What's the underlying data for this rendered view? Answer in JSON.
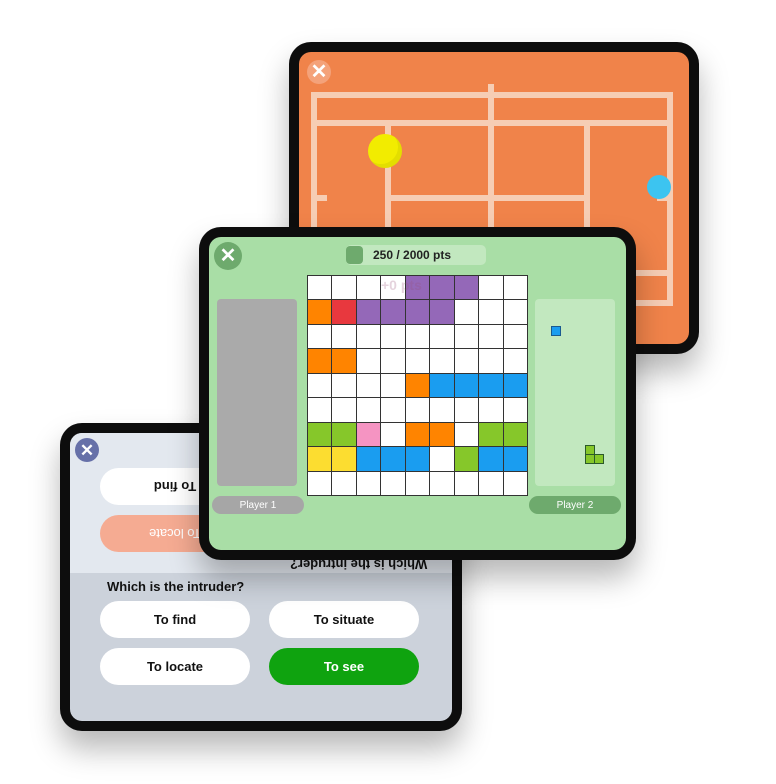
{
  "tennis_game": {
    "close_icon": "✕",
    "court_color": "#f0834a",
    "line_color": "#f6cdb4",
    "balls": [
      {
        "name": "yellow-tennis-ball",
        "color": "#f2ec00"
      },
      {
        "name": "blue-tennis-ball",
        "color": "#3cc4f0"
      }
    ]
  },
  "puzzle_game": {
    "close_icon": "✕",
    "score": "250",
    "score_separator": " / ",
    "score_total": "2000 pts",
    "score_label": "250  / 2000 pts",
    "ghost_text": "+0 pts",
    "grid": [
      [
        "#ffffff",
        "#ffffff",
        "#ffffff",
        "#ffffff",
        "#9468b8",
        "#9468b8",
        "#9468b8",
        "#ffffff",
        "#ffffff"
      ],
      [
        "#ff8400",
        "#e8383e",
        "#9468b8",
        "#9468b8",
        "#9468b8",
        "#9468b8",
        "#ffffff",
        "#ffffff",
        "#ffffff"
      ],
      [
        "#ffffff",
        "#ffffff",
        "#ffffff",
        "#ffffff",
        "#ffffff",
        "#ffffff",
        "#ffffff",
        "#ffffff",
        "#ffffff"
      ],
      [
        "#ff8400",
        "#ff8400",
        "#ffffff",
        "#ffffff",
        "#ffffff",
        "#ffffff",
        "#ffffff",
        "#ffffff",
        "#ffffff"
      ],
      [
        "#ffffff",
        "#ffffff",
        "#ffffff",
        "#ffffff",
        "#ff8400",
        "#1a9df0",
        "#1a9df0",
        "#1a9df0",
        "#1a9df0"
      ],
      [
        "#ffffff",
        "#ffffff",
        "#ffffff",
        "#ffffff",
        "#ffffff",
        "#ffffff",
        "#ffffff",
        "#ffffff",
        "#ffffff"
      ],
      [
        "#86c72a",
        "#86c72a",
        "#f594c2",
        "#ffffff",
        "#ff8400",
        "#ff8400",
        "#ffffff",
        "#86c72a",
        "#86c72a"
      ],
      [
        "#fcdd30",
        "#fcdd30",
        "#1a9df0",
        "#1a9df0",
        "#1a9df0",
        "#ffffff",
        "#86c72a",
        "#1a9df0",
        "#1a9df0"
      ],
      [
        "#ffffff",
        "#ffffff",
        "#ffffff",
        "#ffffff",
        "#ffffff",
        "#ffffff",
        "#ffffff",
        "#ffffff",
        "#ffffff"
      ]
    ],
    "player1_label": "Player 1",
    "player2_label": "Player 2",
    "player2_pieces": [
      {
        "name": "blue-single-piece",
        "color": "#1a9df0"
      },
      {
        "name": "green-l-piece",
        "color": "#86c72a"
      }
    ]
  },
  "quiz_game": {
    "close_icon": "✕",
    "question": "Which is the intruder?",
    "answers": [
      {
        "label": "To find",
        "state": "default"
      },
      {
        "label": "To situate",
        "state": "default"
      },
      {
        "label": "To locate",
        "state": "default"
      },
      {
        "label": "To see",
        "state": "correct",
        "color": "#0fa30f"
      }
    ],
    "flipped_question": "Which is the intruder?",
    "flipped_answers": [
      {
        "label": "To find",
        "state": "default"
      },
      {
        "label": "To locate",
        "state": "wrong",
        "color": "#f5ab92"
      }
    ]
  }
}
